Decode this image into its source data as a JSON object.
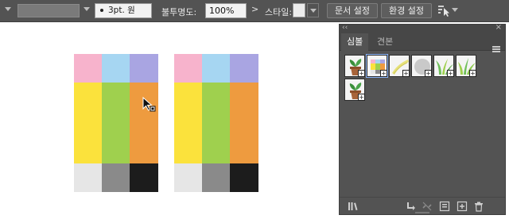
{
  "toolbar": {
    "brush_value": "3pt. 원",
    "opacity_label": "불투명도:",
    "opacity_value": "100%",
    "opacity_arrow": ">",
    "style_label": "스타일:",
    "doc_setup_label": "문서 설정",
    "preferences_label": "환경 설정"
  },
  "panel": {
    "collapse_glyph": "‹‹",
    "close_glyph": "×",
    "tabs": [
      {
        "label": "심볼",
        "active": true
      },
      {
        "label": "견본",
        "active": false
      }
    ],
    "symbols": [
      {
        "name": "potted-plant",
        "selected": false
      },
      {
        "name": "color-palette",
        "selected": true
      },
      {
        "name": "yellow-brush-stroke",
        "selected": false
      },
      {
        "name": "gray-circle",
        "selected": false
      },
      {
        "name": "grass-tuft",
        "selected": false
      },
      {
        "name": "grass-tuft-2",
        "selected": false
      },
      {
        "name": "potted-plant-2",
        "selected": false
      }
    ],
    "footer_icons": [
      "symbol-libraries-icon",
      "place-symbol-icon",
      "break-link-icon",
      "symbol-options-icon",
      "new-symbol-icon",
      "delete-symbol-icon"
    ]
  },
  "artwork": {
    "top_row": [
      "#f7b3cc",
      "#a6d6f2",
      "#a9a5e2"
    ],
    "mid_row": [
      "#fbe23c",
      "#9fd04e",
      "#ee9b3f"
    ],
    "bottom_row": [
      "#e6e6e6",
      "#8a8a8a",
      "#1c1c1c"
    ]
  }
}
